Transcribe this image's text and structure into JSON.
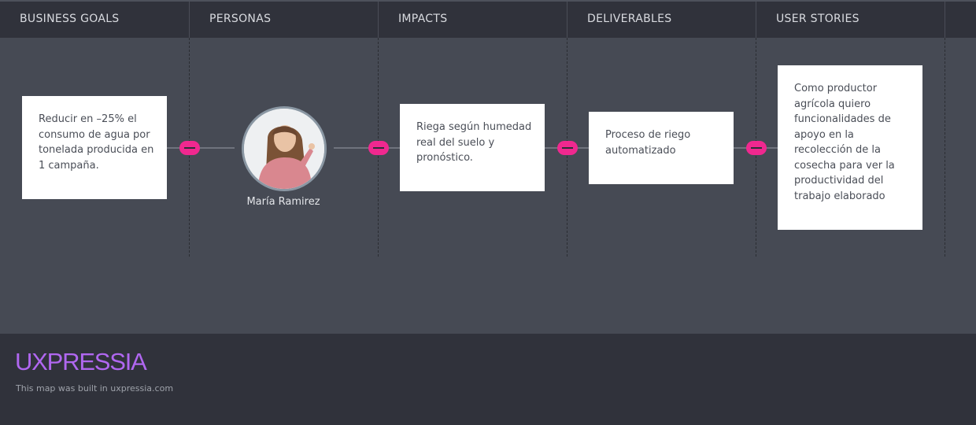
{
  "columns": [
    "BUSINESS GOALS",
    "PERSONAS",
    "IMPACTS",
    "DELIVERABLES",
    "USER STORIES"
  ],
  "business_goal": {
    "text": "Reducir en –25% el consumo de agua por tonelada producida en 1 campaña."
  },
  "persona": {
    "name": "María Ramirez"
  },
  "impact": {
    "text": "Riega según humedad real del suelo y pronóstico."
  },
  "deliverable": {
    "text": "Proceso de riego automatizado"
  },
  "user_story": {
    "text": "Como productor agrícola quiero funcionalidades de apoyo en la recolección de la cosecha para ver la productividad del trabajo elaborado"
  },
  "footer": {
    "logo_text": "UXPRESSIA",
    "credit": "This map was built in uxpressia.com"
  },
  "colors": {
    "header_bg": "#30323b",
    "canvas_bg": "#464a54",
    "toggle": "#f0288f",
    "logo": "#b067f0"
  }
}
